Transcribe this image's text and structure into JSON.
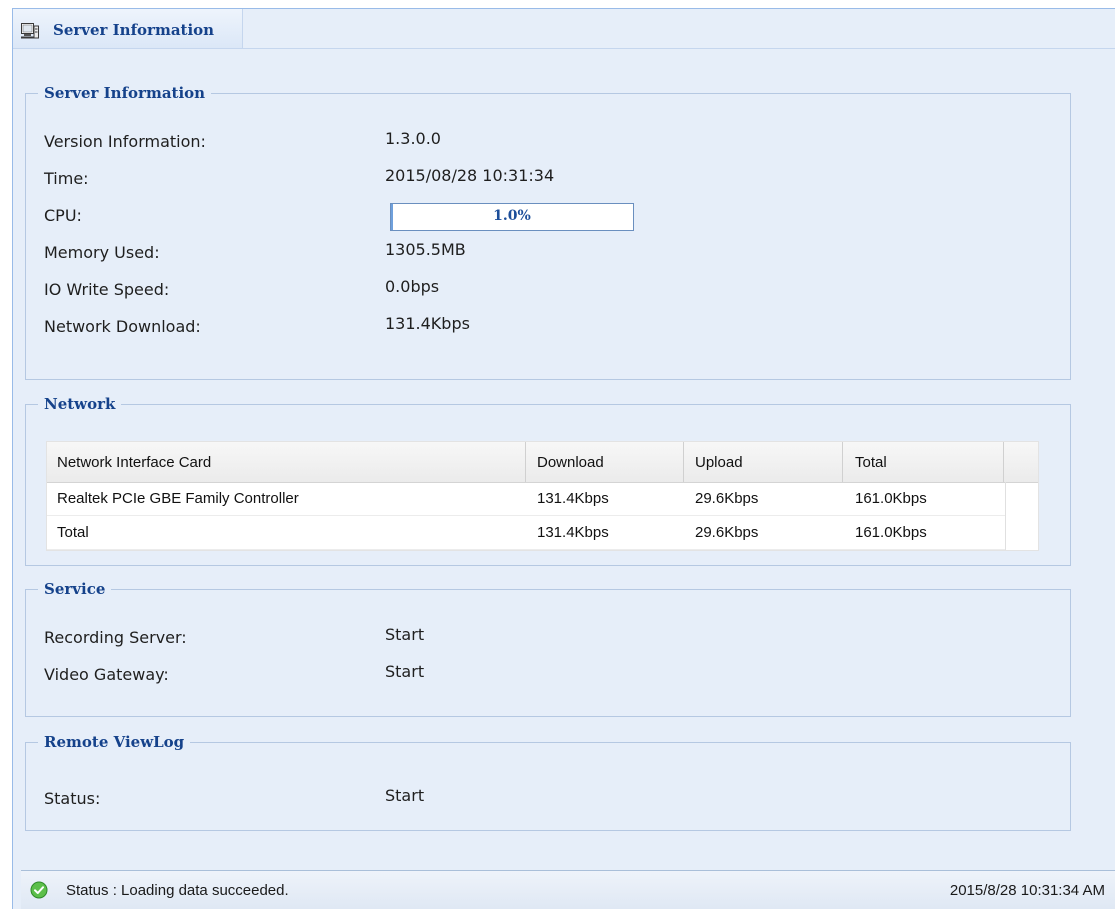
{
  "panel": {
    "title": "Server Information",
    "icon": "server-console-icon"
  },
  "server_info": {
    "title": "Server Information",
    "rows": [
      {
        "label": "Version Information:",
        "value": "1.3.0.0"
      },
      {
        "label": "Time:",
        "value": "2015/08/28 10:31:34"
      },
      {
        "label": "CPU:",
        "value": "1.0%"
      },
      {
        "label": "Memory Used:",
        "value": "1305.5MB"
      },
      {
        "label": "IO Write Speed:",
        "value": "0.0bps"
      },
      {
        "label": "Network Download:",
        "value": "131.4Kbps"
      }
    ],
    "cpu_fraction": 0.01
  },
  "network": {
    "title": "Network",
    "columns": [
      "Network Interface Card",
      "Download",
      "Upload",
      "Total"
    ],
    "rows": [
      [
        "Realtek PCIe GBE Family Controller",
        "131.4Kbps",
        "29.6Kbps",
        "161.0Kbps"
      ],
      [
        "Total",
        "131.4Kbps",
        "29.6Kbps",
        "161.0Kbps"
      ]
    ]
  },
  "service": {
    "title": "Service",
    "rows": [
      {
        "label": "Recording Server:",
        "value": "Start"
      },
      {
        "label": "Video Gateway:",
        "value": "Start"
      }
    ]
  },
  "remote_viewlog": {
    "title": "Remote ViewLog",
    "rows": [
      {
        "label": "Status:",
        "value": "Start"
      }
    ]
  },
  "status_bar": {
    "icon": "check-circle-icon",
    "text": "Status : Loading data succeeded.",
    "timestamp": "2015/8/28 10:31:34 AM"
  },
  "colors": {
    "accent": "#15428b",
    "panel_bg": "#e6eef9",
    "progress_fill": "#6fa0dc",
    "success": "#3fae3f"
  }
}
